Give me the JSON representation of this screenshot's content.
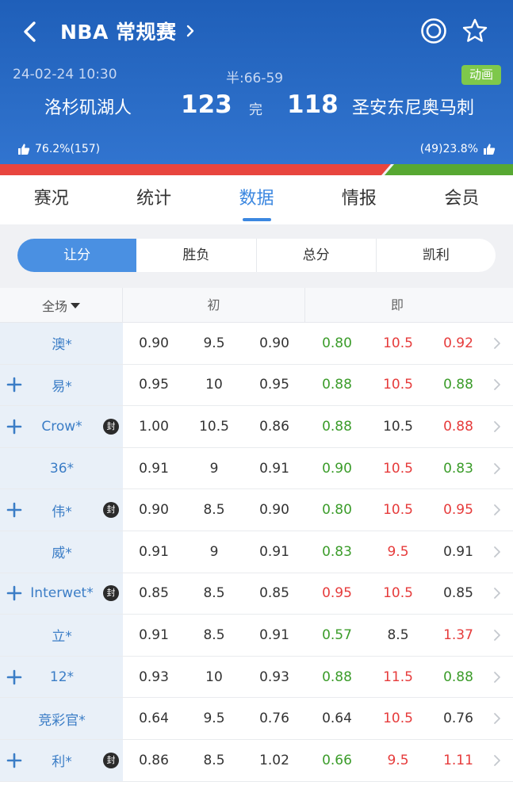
{
  "header": {
    "title": "NBA 常规赛",
    "datetime": "24-02-24 10:30",
    "halftime": "半:66-59",
    "anim_badge": "动画",
    "home_team": "洛杉矶湖人",
    "home_score": "123",
    "status": "完",
    "away_score": "118",
    "away_team": "圣安东尼奥马刺",
    "home_vote": "76.2%(157)",
    "away_vote": "(49)23.8%",
    "home_vote_share": 0.762,
    "colors": {
      "home": "#e8453e",
      "away": "#57a832",
      "accent": "#3b87e0"
    }
  },
  "tabs": [
    {
      "label": "赛况",
      "active": false
    },
    {
      "label": "统计",
      "active": false
    },
    {
      "label": "数据",
      "active": true
    },
    {
      "label": "情报",
      "active": false
    },
    {
      "label": "会员",
      "active": false
    }
  ],
  "segments": [
    {
      "label": "让分",
      "active": true
    },
    {
      "label": "胜负",
      "active": false
    },
    {
      "label": "总分",
      "active": false
    },
    {
      "label": "凯利",
      "active": false
    }
  ],
  "table": {
    "scope": "全场",
    "head_initial": "初",
    "head_live": "即",
    "rows": [
      {
        "company": "澳*",
        "plus": false,
        "seal": "",
        "init": [
          "0.90",
          "9.5",
          "0.90"
        ],
        "live": [
          "0.80",
          "10.5",
          "0.92"
        ],
        "live_colors": [
          "green",
          "red",
          "red"
        ]
      },
      {
        "company": "易*",
        "plus": true,
        "seal": "",
        "init": [
          "0.95",
          "10",
          "0.95"
        ],
        "live": [
          "0.88",
          "10.5",
          "0.88"
        ],
        "live_colors": [
          "green",
          "red",
          "green"
        ]
      },
      {
        "company": "Crow*",
        "plus": true,
        "seal": "封",
        "init": [
          "1.00",
          "10.5",
          "0.86"
        ],
        "live": [
          "0.88",
          "10.5",
          "0.88"
        ],
        "live_colors": [
          "green",
          "",
          "red"
        ]
      },
      {
        "company": "36*",
        "plus": false,
        "seal": "",
        "init": [
          "0.91",
          "9",
          "0.91"
        ],
        "live": [
          "0.90",
          "10.5",
          "0.83"
        ],
        "live_colors": [
          "green",
          "red",
          "green"
        ]
      },
      {
        "company": "伟*",
        "plus": true,
        "seal": "封",
        "init": [
          "0.90",
          "8.5",
          "0.90"
        ],
        "live": [
          "0.80",
          "10.5",
          "0.95"
        ],
        "live_colors": [
          "green",
          "red",
          "red"
        ]
      },
      {
        "company": "威*",
        "plus": false,
        "seal": "",
        "init": [
          "0.91",
          "9",
          "0.91"
        ],
        "live": [
          "0.83",
          "9.5",
          "0.91"
        ],
        "live_colors": [
          "green",
          "red",
          ""
        ]
      },
      {
        "company": "Interwet*",
        "plus": true,
        "seal": "封",
        "init": [
          "0.85",
          "8.5",
          "0.85"
        ],
        "live": [
          "0.95",
          "10.5",
          "0.85"
        ],
        "live_colors": [
          "red",
          "red",
          ""
        ]
      },
      {
        "company": "立*",
        "plus": false,
        "seal": "",
        "init": [
          "0.91",
          "8.5",
          "0.91"
        ],
        "live": [
          "0.57",
          "8.5",
          "1.37"
        ],
        "live_colors": [
          "green",
          "",
          "red"
        ]
      },
      {
        "company": "12*",
        "plus": true,
        "seal": "",
        "init": [
          "0.93",
          "10",
          "0.93"
        ],
        "live": [
          "0.88",
          "11.5",
          "0.88"
        ],
        "live_colors": [
          "green",
          "red",
          "green"
        ]
      },
      {
        "company": "竞彩官*",
        "plus": false,
        "seal": "",
        "init": [
          "0.64",
          "9.5",
          "0.76"
        ],
        "live": [
          "0.64",
          "10.5",
          "0.76"
        ],
        "live_colors": [
          "",
          "red",
          ""
        ]
      },
      {
        "company": "利*",
        "plus": true,
        "seal": "封",
        "init": [
          "0.86",
          "8.5",
          "1.02"
        ],
        "live": [
          "0.66",
          "9.5",
          "1.11"
        ],
        "live_colors": [
          "green",
          "red",
          "red"
        ]
      }
    ]
  }
}
